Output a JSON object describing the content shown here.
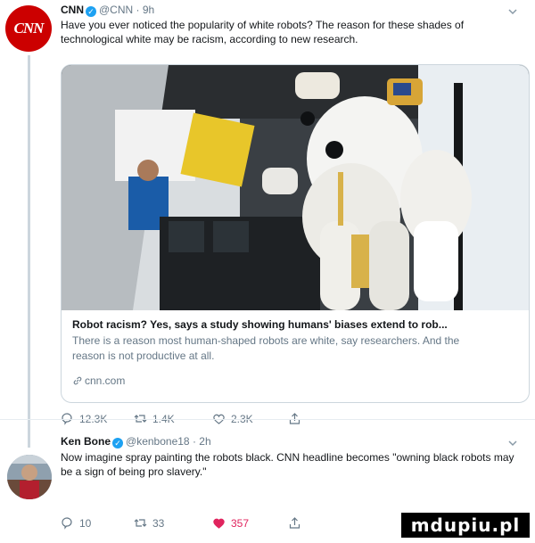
{
  "tweet1": {
    "name": "CNN",
    "handle": "@CNN",
    "separator": "·",
    "time": "9h",
    "avatar_logo": "CNN",
    "text": "Have you ever noticed the popularity of white robots? The reason for these shades of technological white may be racism, according to new research.",
    "card": {
      "title": "Robot racism? Yes, says a study showing humans' biases extend to rob...",
      "description": "There is a reason most human-shaped robots are white, say researchers. And the reason is not productive at all.",
      "domain": "cnn.com"
    },
    "actions": {
      "replies": "12.3K",
      "retweets": "1.4K",
      "likes": "2.3K"
    }
  },
  "tweet2": {
    "name": "Ken Bone",
    "handle": "@kenbone18",
    "separator": "·",
    "time": "2h",
    "text": "Now imagine spray painting the robots black. CNN headline becomes \"owning black robots may be a sign of being pro slavery.\"",
    "actions": {
      "replies": "10",
      "retweets": "33",
      "likes": "357"
    }
  },
  "watermark": "mdupiu.pl",
  "colors": {
    "verified": "#1da1f2",
    "muted": "#657786",
    "liked": "#e0245e",
    "cnn_red": "#cc0000"
  },
  "icons": [
    "chevron-down-icon",
    "verified-icon",
    "reply-icon",
    "retweet-icon",
    "like-icon",
    "share-icon",
    "link-icon"
  ]
}
